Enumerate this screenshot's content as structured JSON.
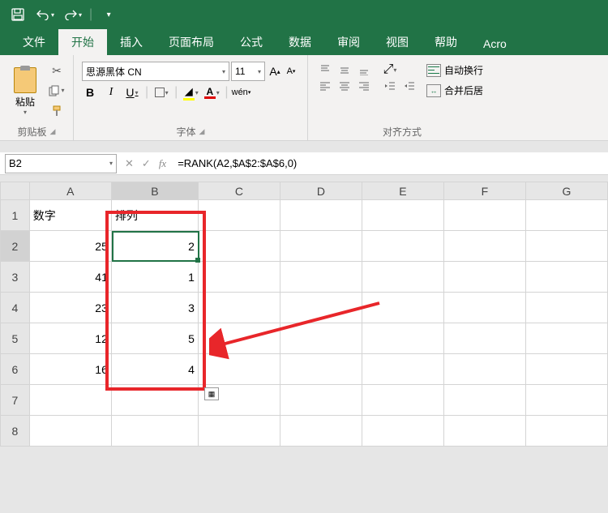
{
  "titlebar": {
    "save_icon": "save",
    "undo_icon": "undo",
    "redo_icon": "redo"
  },
  "tabs": {
    "file": "文件",
    "home": "开始",
    "insert": "插入",
    "layout": "页面布局",
    "formulas": "公式",
    "data": "数据",
    "review": "审阅",
    "view": "视图",
    "help": "帮助",
    "acrobat": "Acro"
  },
  "ribbon": {
    "clipboard": {
      "paste": "粘贴",
      "group": "剪贴板"
    },
    "font": {
      "name": "思源黑体 CN",
      "size": "11",
      "bold": "B",
      "italic": "I",
      "underline": "U",
      "wen": "wén",
      "group": "字体"
    },
    "align": {
      "wrap": "自动换行",
      "merge": "合并后居",
      "group": "对齐方式"
    }
  },
  "namebox": {
    "ref": "B2"
  },
  "formula": {
    "value": "=RANK(A2,$A$2:$A$6,0)"
  },
  "columns": [
    "A",
    "B",
    "C",
    "D",
    "E",
    "F",
    "G"
  ],
  "rows": [
    "1",
    "2",
    "3",
    "4",
    "5",
    "6",
    "7",
    "8"
  ],
  "cells": {
    "A1": "数字",
    "B1": "排列",
    "A2": "25",
    "B2": "2",
    "A3": "41",
    "B3": "1",
    "A4": "23",
    "B4": "3",
    "A5": "12",
    "B5": "5",
    "A6": "16",
    "B6": "4"
  }
}
